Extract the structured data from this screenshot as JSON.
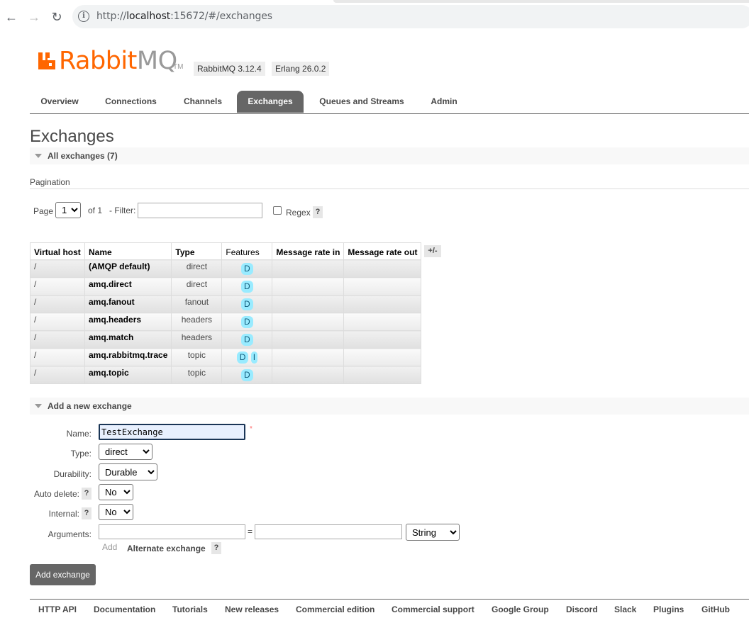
{
  "browser": {
    "url_prefix": "http://",
    "url_host": "localhost",
    "url_rest": ":15672/#/exchanges"
  },
  "logo": {
    "rabbit": "Rabbit",
    "mq": "MQ",
    "tm": "TM",
    "color": "#ff6600"
  },
  "versions": [
    "RabbitMQ 3.12.4",
    "Erlang 26.0.2"
  ],
  "tabs": [
    {
      "label": "Overview",
      "active": false
    },
    {
      "label": "Connections",
      "active": false
    },
    {
      "label": "Channels",
      "active": false
    },
    {
      "label": "Exchanges",
      "active": true
    },
    {
      "label": "Queues and Streams",
      "active": false
    },
    {
      "label": "Admin",
      "active": false
    }
  ],
  "page_title": "Exchanges",
  "all_exchanges_header": "All exchanges (7)",
  "pagination": {
    "label": "Pagination",
    "page_label": "Page",
    "page_value": "1",
    "of_label": "of 1",
    "filter_label": "- Filter:",
    "filter_value": "",
    "regex_label": "Regex",
    "regex_checked": false,
    "help": "?"
  },
  "table": {
    "columns": [
      "Virtual host",
      "Name",
      "Type",
      "Features",
      "Message rate in",
      "Message rate out"
    ],
    "toggle_label": "+/-",
    "rows": [
      {
        "vhost": "/",
        "name": "(AMQP default)",
        "type": "direct",
        "features": [
          "D"
        ],
        "rate_in": "",
        "rate_out": ""
      },
      {
        "vhost": "/",
        "name": "amq.direct",
        "type": "direct",
        "features": [
          "D"
        ],
        "rate_in": "",
        "rate_out": ""
      },
      {
        "vhost": "/",
        "name": "amq.fanout",
        "type": "fanout",
        "features": [
          "D"
        ],
        "rate_in": "",
        "rate_out": ""
      },
      {
        "vhost": "/",
        "name": "amq.headers",
        "type": "headers",
        "features": [
          "D"
        ],
        "rate_in": "",
        "rate_out": ""
      },
      {
        "vhost": "/",
        "name": "amq.match",
        "type": "headers",
        "features": [
          "D"
        ],
        "rate_in": "",
        "rate_out": ""
      },
      {
        "vhost": "/",
        "name": "amq.rabbitmq.trace",
        "type": "topic",
        "features": [
          "D",
          "I"
        ],
        "rate_in": "",
        "rate_out": ""
      },
      {
        "vhost": "/",
        "name": "amq.topic",
        "type": "topic",
        "features": [
          "D"
        ],
        "rate_in": "",
        "rate_out": ""
      }
    ],
    "feature_color": "#99ebff"
  },
  "add_exchange": {
    "header": "Add a new exchange",
    "name_label": "Name:",
    "name_value": "TestExchange",
    "required_mark": "*",
    "type_label": "Type:",
    "type_value": "direct",
    "durability_label": "Durability:",
    "durability_value": "Durable",
    "auto_delete_label": "Auto delete:",
    "auto_delete_value": "No",
    "internal_label": "Internal:",
    "internal_value": "No",
    "arguments_label": "Arguments:",
    "arg_key": "",
    "arg_equals": "=",
    "arg_value": "",
    "arg_type": "String",
    "add_link": "Add",
    "alternate_exchange": "Alternate exchange",
    "help": "?",
    "submit_label": "Add exchange"
  },
  "footer_links": [
    "HTTP API",
    "Documentation",
    "Tutorials",
    "New releases",
    "Commercial edition",
    "Commercial support",
    "Google Group",
    "Discord",
    "Slack",
    "Plugins",
    "GitHub"
  ]
}
